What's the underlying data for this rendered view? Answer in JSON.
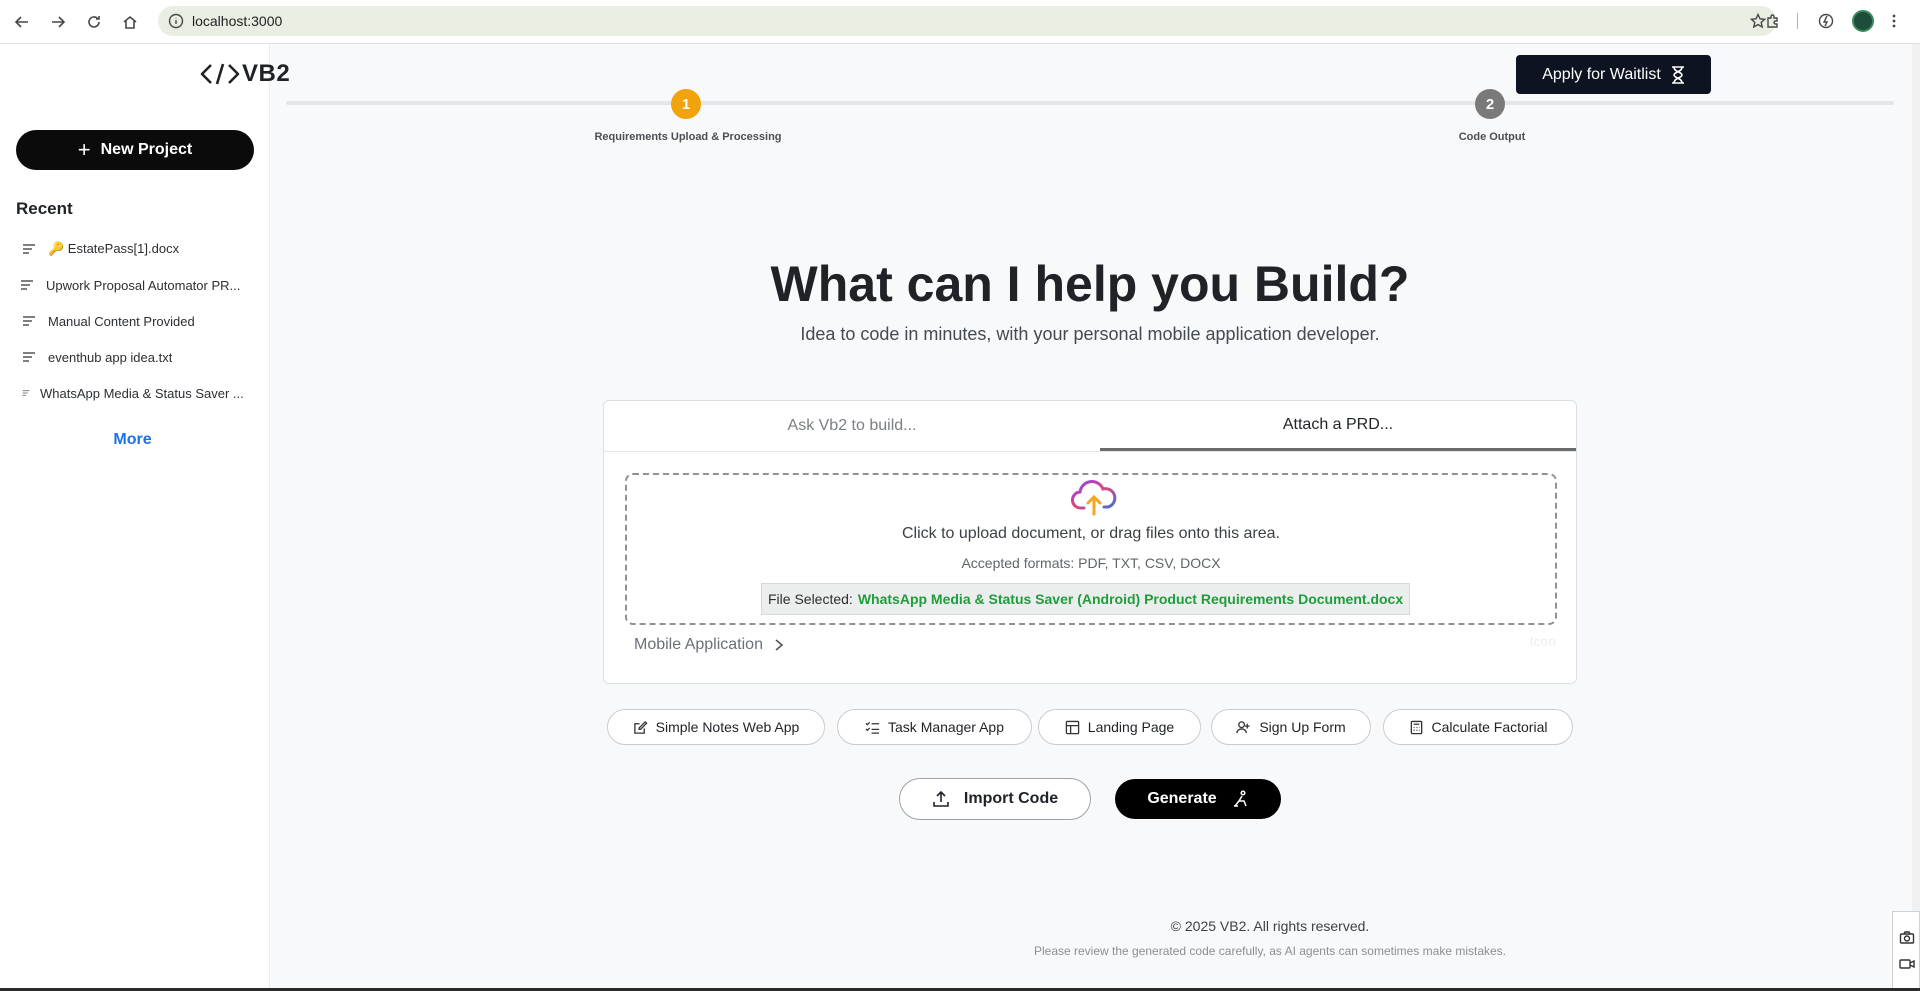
{
  "browser": {
    "url": "localhost:3000"
  },
  "brand": {
    "name": "VB2"
  },
  "sidebar": {
    "new_project_label": "New Project",
    "recent_title": "Recent",
    "recent_items": [
      {
        "label": "🔑 EstatePass[1].docx"
      },
      {
        "label": "Upwork Proposal Automator PR..."
      },
      {
        "label": "Manual Content Provided"
      },
      {
        "label": "eventhub app idea.txt"
      },
      {
        "label": "WhatsApp Media & Status Saver ..."
      }
    ],
    "more_label": "More"
  },
  "header": {
    "waitlist_label": "Apply for Waitlist",
    "steps": [
      {
        "number": "1",
        "label": "Requirements Upload & Processing",
        "color": "#f0a30a"
      },
      {
        "number": "2",
        "label": "Code Output",
        "color": "#7a7a7a"
      }
    ]
  },
  "hero": {
    "title": "What can I help you Build?",
    "subtitle": "Idea to code in minutes, with your personal mobile application developer."
  },
  "card": {
    "tabs": [
      {
        "label": "Ask Vb2 to build..."
      },
      {
        "label": "Attach a PRD..."
      }
    ],
    "active_tab": "Attach a PRD...",
    "upload_text": "Click to upload document, or drag files onto this area.",
    "accepted_formats": "Accepted formats: PDF, TXT, CSV, DOCX",
    "file_selected_label": "File Selected:",
    "file_name": "WhatsApp Media & Status Saver (Android) Product Requirements Document.docx",
    "app_type": "Mobile Application",
    "icon_placeholder": "Icon"
  },
  "suggestions": [
    {
      "label": "Simple Notes Web App",
      "icon": "edit-note-icon"
    },
    {
      "label": "Task Manager App",
      "icon": "checklist-icon"
    },
    {
      "label": "Landing Page",
      "icon": "layout-icon"
    },
    {
      "label": "Sign Up Form",
      "icon": "user-plus-icon"
    },
    {
      "label": "Calculate Factorial",
      "icon": "calculator-icon"
    }
  ],
  "actions": {
    "import_label": "Import Code",
    "generate_label": "Generate"
  },
  "footer": {
    "copyright": "© 2025 VB2. All rights reserved.",
    "disclaimer": "Please review the generated code carefully, as AI agents can sometimes make mistakes."
  },
  "colors": {
    "accent_step_active": "#f0a30a",
    "file_name_green": "#1e9e3a",
    "primary_dark": "#0d1321"
  }
}
